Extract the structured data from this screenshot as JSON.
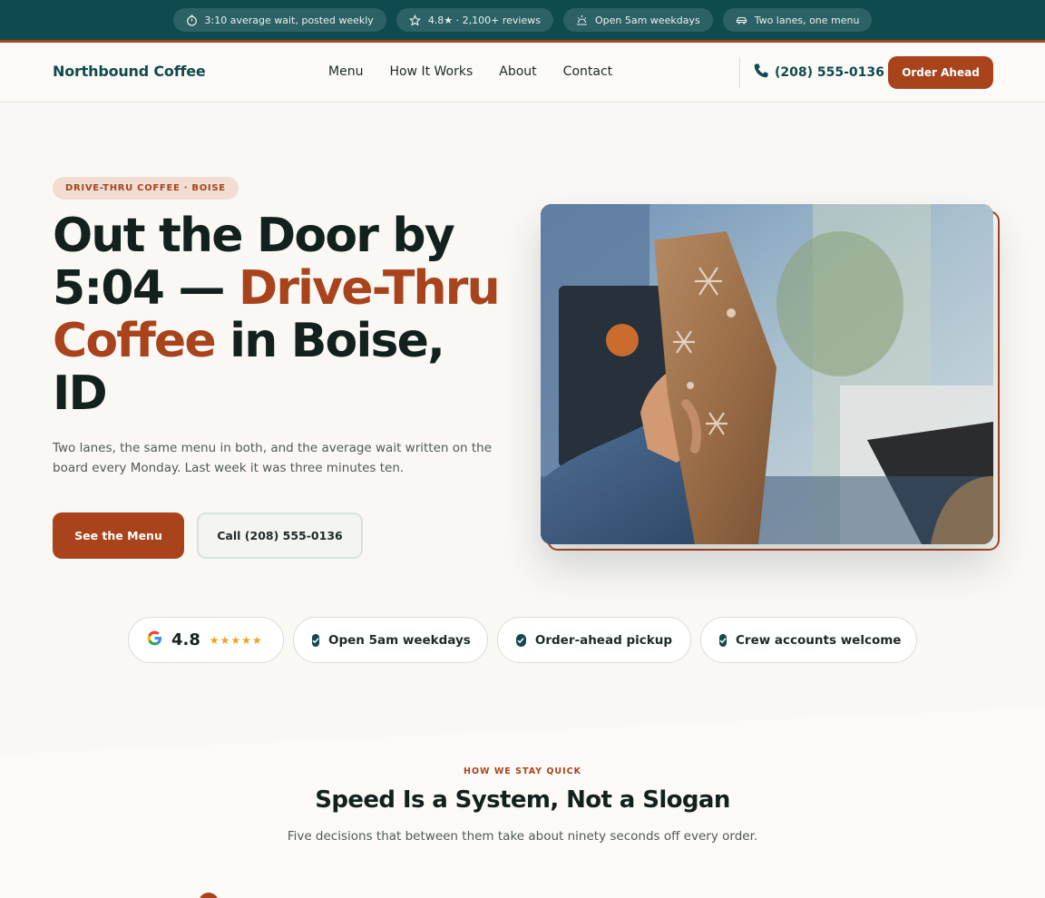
{
  "topbar": {
    "pills": [
      {
        "icon": "timer-icon",
        "text": "3:10 average wait, posted weekly"
      },
      {
        "icon": "star-icon",
        "text": "4.8★ · 2,100+ reviews"
      },
      {
        "icon": "sunrise-icon",
        "text": "Open 5am weekdays"
      },
      {
        "icon": "car-icon",
        "text": "Two lanes, one menu"
      }
    ]
  },
  "header": {
    "brand": "Northbound Coffee",
    "nav": [
      "Menu",
      "How It Works",
      "About",
      "Contact"
    ],
    "phone": "(208) 555-0136",
    "cta": "Order Ahead"
  },
  "hero": {
    "badge": "DRIVE-THRU COFFEE · BOISE",
    "headline_a": "Out the Door by 5:04 — ",
    "headline_accent": "Drive-Thru Coffee",
    "headline_b": " in Boise, ID",
    "subtitle": "Two lanes, the same menu in both, and the average wait written on the board every Monday. Last week it was three minutes ten.",
    "primary_cta": "See the Menu",
    "secondary_cta": "Call (208) 555-0136"
  },
  "trust": {
    "rating": "4.8",
    "stars": "★★★★★",
    "items": [
      "Open 5am weekdays",
      "Order-ahead pickup",
      "Crew accounts welcome"
    ]
  },
  "section": {
    "eyebrow": "HOW WE STAY QUICK",
    "title": "Speed Is a System, Not a Slogan",
    "subtitle": "Five decisions that between them take about ninety seconds off every order."
  },
  "colors": {
    "teal": "#0f4a4e",
    "rust": "#a8431c",
    "background": "#faf8f4"
  }
}
